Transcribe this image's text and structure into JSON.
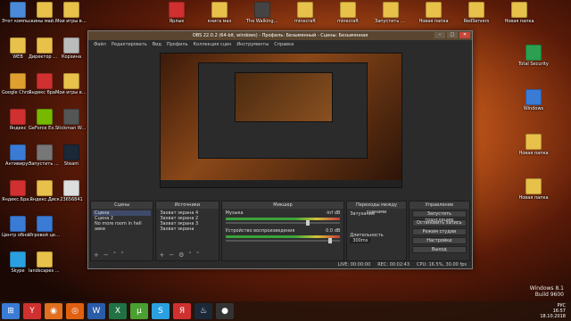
{
  "desktop_icons": {
    "left_col": [
      {
        "label": "Этот компьютер",
        "color": "#4a8ad8"
      },
      {
        "label": "WEB",
        "color": "#e8c14a"
      },
      {
        "label": "Google Chrome",
        "color": "#e0a030"
      },
      {
        "label": "Яндекс",
        "color": "#d03030"
      },
      {
        "label": "Антивирус",
        "color": "#3a7bd5"
      },
      {
        "label": "Яндекс.Браузер",
        "color": "#d03030"
      },
      {
        "label": "Центр обновления",
        "color": "#3a7bd5"
      },
      {
        "label": "Skype",
        "color": "#2aa0e0"
      },
      {
        "label": "скины майнкрафт",
        "color": "#e8c14a"
      },
      {
        "label": "Директор шаблон",
        "color": "#e8c14a"
      },
      {
        "label": "Яндекс браузер",
        "color": "#d03030"
      },
      {
        "label": "GeForce Experience",
        "color": "#76b900"
      },
      {
        "label": "Запустить Left 4 Dead 2",
        "color": "#777"
      },
      {
        "label": "Яндекс.Диск",
        "color": "#e8c14a"
      },
      {
        "label": "Игровой центр",
        "color": "#3a7bd5"
      },
      {
        "label": "landscapes cityscapes",
        "color": "#e8c14a"
      },
      {
        "label": "Мои игры в Браузере",
        "color": "#e8c14a"
      },
      {
        "label": "Корзина",
        "color": "#bbbbbb"
      },
      {
        "label": "Мои игры в Браузере",
        "color": "#e8c14a"
      },
      {
        "label": "Stickman Wars",
        "color": "#555"
      },
      {
        "label": "Steam",
        "color": "#1b2838"
      },
      {
        "label": "23656841",
        "color": "#ddd"
      }
    ],
    "top_row": [
      {
        "label": "Ярлык",
        "color": "#d03030"
      },
      {
        "label": "книга маэ",
        "color": "#e8c14a"
      },
      {
        "label": "The Walking Dead",
        "color": "#444"
      },
      {
        "label": "minecraft",
        "color": "#e8c14a"
      },
      {
        "label": "minecraft",
        "color": "#e8c14a"
      },
      {
        "label": "Запустить ярлык",
        "color": "#e8c14a"
      },
      {
        "label": "Новая папка",
        "color": "#e8c14a"
      },
      {
        "label": "RedServers",
        "color": "#e8c14a"
      },
      {
        "label": "Новая папка",
        "color": "#e8c14a"
      }
    ],
    "right_col": [
      {
        "label": "Total Security",
        "color": "#2aa050"
      },
      {
        "label": "Windows",
        "color": "#3a7bd5"
      },
      {
        "label": "Новая папка",
        "color": "#e8c14a"
      },
      {
        "label": "Новая папка",
        "color": "#e8c14a"
      }
    ]
  },
  "obs": {
    "title": "OBS 22.0.2 (64-bit, windows) - Профиль: Безымянный - Сцены: Безымянная",
    "menu": [
      "Файл",
      "Редактировать",
      "Вид",
      "Профиль",
      "Коллекция сцен",
      "Инструменты",
      "Справка"
    ],
    "docks": {
      "scenes": {
        "title": "Сцены",
        "items": [
          "Сцена",
          "Сцена 2",
          "No more room in hell",
          "aвкв"
        ]
      },
      "sources": {
        "title": "Источники",
        "items": [
          "Захват экрана 4",
          "Захват экрана 2",
          "Захват экрана 3",
          "Захват экрана"
        ]
      },
      "mixer": {
        "title": "Микшер",
        "channels": [
          {
            "name": "Музыка",
            "db": "-inf dB",
            "level": 0.7
          },
          {
            "name": "Устройство воспроизведения",
            "db": "0.0 dB",
            "level": 0.9
          }
        ]
      },
      "transitions": {
        "title": "Переходы между сценами",
        "type": "Затухание",
        "duration_label": "Длительность",
        "duration": "300ms"
      },
      "controls": {
        "title": "Управление",
        "buttons": [
          "Запустить трансляцию",
          "Остановить запись",
          "Режим студии",
          "Настройки",
          "Выход"
        ]
      }
    },
    "status": {
      "live": "LIVE: 00:00:00",
      "rec": "REC: 00:02:43",
      "cpu": "CPU: 16.5%, 30.00 fps"
    }
  },
  "taskbar": {
    "apps": [
      {
        "icon": "start-icon",
        "glyph": "⊞",
        "color": "#3a7bd5"
      },
      {
        "icon": "yandex-icon",
        "glyph": "Y",
        "color": "#d03030"
      },
      {
        "icon": "firefox-icon",
        "glyph": "◉",
        "color": "#e07020"
      },
      {
        "icon": "games-icon",
        "glyph": "◎",
        "color": "#e06010"
      },
      {
        "icon": "word-icon",
        "glyph": "W",
        "color": "#2a5caa"
      },
      {
        "icon": "excel-icon",
        "glyph": "X",
        "color": "#207245"
      },
      {
        "icon": "utorrent-icon",
        "glyph": "µ",
        "color": "#4aa030"
      },
      {
        "icon": "skype-icon",
        "glyph": "S",
        "color": "#2aa0e0"
      },
      {
        "icon": "yandex-browser-icon",
        "glyph": "Я",
        "color": "#d03030"
      },
      {
        "icon": "steam-icon",
        "glyph": "♨",
        "color": "#1b2838"
      },
      {
        "icon": "obs-icon",
        "glyph": "●",
        "color": "#333"
      }
    ],
    "lang": "РУС",
    "time": "16:57",
    "date": "18.10.2018"
  },
  "watermark": {
    "line1": "Windows 8.1",
    "line2": "Build 9600"
  }
}
